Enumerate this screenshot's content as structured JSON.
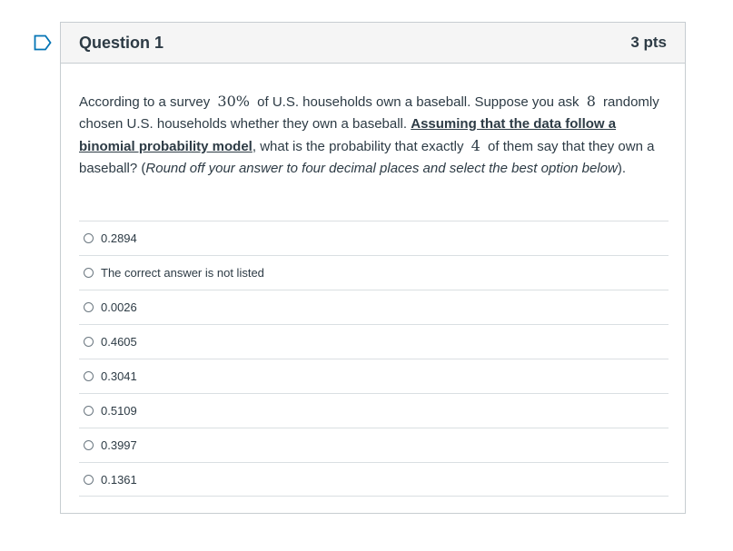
{
  "question": {
    "title": "Question 1",
    "points": "3 pts",
    "text_part1": "According to a survey ",
    "math_percent": "30%",
    "text_part2": " of U.S. households own a baseball. Suppose you ask ",
    "math_n": "8",
    "text_part3": " randomly chosen U.S. households whether they own a baseball. ",
    "bold_underlined": "Assuming that the data follow a binomial probability model",
    "text_part4": ", what is the probability that exactly ",
    "math_k": "4",
    "text_part5": " of them say that they own a baseball? (",
    "italic_instruction": "Round off your answer to four decimal places and select the best option below",
    "text_part6": ")."
  },
  "answers": [
    {
      "label": "0.2894"
    },
    {
      "label": "The correct answer is not listed"
    },
    {
      "label": "0.0026"
    },
    {
      "label": "0.4605"
    },
    {
      "label": "0.3041"
    },
    {
      "label": "0.5109"
    },
    {
      "label": "0.3997"
    },
    {
      "label": "0.1361"
    }
  ],
  "colors": {
    "accent": "#0374b5",
    "text": "#2d3b45",
    "header_bg": "#f5f5f5",
    "border": "#c7cdd1"
  }
}
